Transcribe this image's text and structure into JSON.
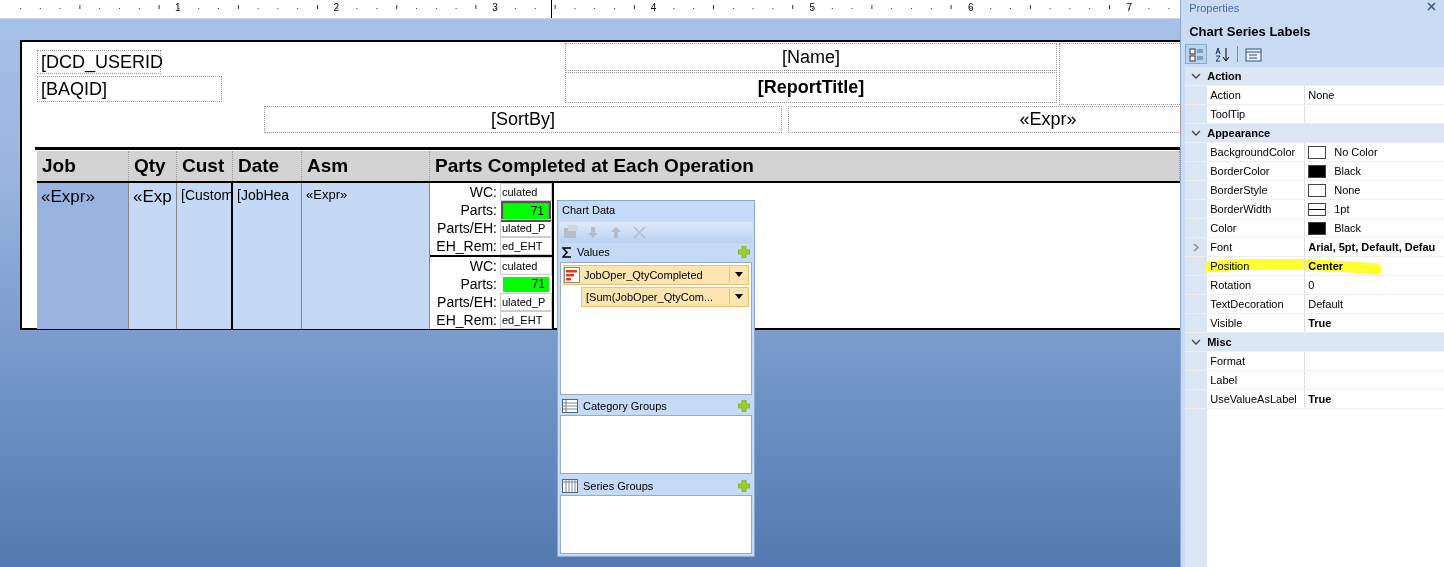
{
  "ruler": {
    "numbers": [
      "1",
      "2",
      "3",
      "4",
      "5",
      "6",
      "7"
    ]
  },
  "report": {
    "fields": [
      {
        "kind": "userid",
        "text": "[DCD_USERID"
      },
      {
        "kind": "baqid",
        "text": "[BAQID]"
      },
      {
        "kind": "name",
        "text": "[Name]"
      },
      {
        "kind": "title",
        "text": "[ReportTitle]"
      },
      {
        "kind": "sortby",
        "text": "[SortBy]"
      },
      {
        "kind": "expr",
        "text": "«Expr»"
      }
    ],
    "columns": [
      "Job",
      "Qty",
      "Cust",
      "Date",
      "Asm",
      "Parts Completed at Each Operation"
    ],
    "cells": [
      "«Expr»",
      "«Exp",
      "[Custom",
      "[JobHea",
      "«Expr»"
    ],
    "operations": [
      {
        "rows": [
          {
            "label": "WC:",
            "value": "culated",
            "kind": "text"
          },
          {
            "label": "Parts:",
            "value": "71",
            "kind": "bar",
            "selected": true
          },
          {
            "label": "Parts/EH:",
            "value": "ulated_P",
            "kind": "text"
          },
          {
            "label": "EH_Rem:",
            "value": "ed_EHT",
            "kind": "text"
          }
        ]
      },
      {
        "rows": [
          {
            "label": "WC:",
            "value": "culated",
            "kind": "text"
          },
          {
            "label": "Parts:",
            "value": "71",
            "kind": "bar",
            "selected": false
          },
          {
            "label": "Parts/EH:",
            "value": "ulated_P",
            "kind": "text"
          },
          {
            "label": "EH_Rem:",
            "value": "ed_EHT",
            "kind": "text"
          }
        ]
      }
    ]
  },
  "chart_data_panel": {
    "title": "Chart Data",
    "toolbar": [
      {
        "kind": "properties",
        "disabled": true
      },
      {
        "kind": "down",
        "disabled": true
      },
      {
        "kind": "up",
        "disabled": true
      },
      {
        "kind": "delete",
        "disabled": true
      }
    ],
    "sections": [
      {
        "kind": "values",
        "title": "Values",
        "items": [
          {
            "text": "JobOper_QtyCompleted",
            "kind": "series",
            "children": [
              {
                "text": "[Sum(JobOper_QtyCom...",
                "kind": "value"
              }
            ]
          }
        ]
      },
      {
        "kind": "category",
        "title": "Category Groups"
      },
      {
        "kind": "series",
        "title": "Series Groups"
      }
    ]
  },
  "properties": {
    "title": "Properties",
    "object": "Chart Series Labels",
    "toolbar": [
      {
        "kind": "categorized",
        "selected": true
      },
      {
        "kind": "alphabetical",
        "selected": false
      },
      {
        "kind": "pages",
        "selected": false
      }
    ],
    "groups": [
      {
        "title": "Action",
        "expanded": true,
        "rows": [
          {
            "name": "Action",
            "value": "None",
            "bold": false
          },
          {
            "name": "ToolTip",
            "value": "",
            "bold": false
          }
        ]
      },
      {
        "title": "Appearance",
        "expanded": true,
        "rows": [
          {
            "name": "BackgroundColor",
            "value": "No Color",
            "bold": false,
            "color": "#ffffff"
          },
          {
            "name": "BorderColor",
            "value": "Black",
            "bold": false,
            "color": "#000000"
          },
          {
            "name": "BorderStyle",
            "value": "None",
            "bold": false,
            "color": "#ffffff"
          },
          {
            "name": "BorderWidth",
            "value": "1pt",
            "bold": false,
            "kind": "line-width"
          },
          {
            "name": "Color",
            "value": "Black",
            "bold": false,
            "color": "#000000"
          },
          {
            "name": "Font",
            "value": "Arial, 5pt, Default, Defau",
            "bold": true,
            "expanded": false
          },
          {
            "name": "Position",
            "value": "Center",
            "bold": true,
            "highlighted": true
          },
          {
            "name": "Rotation",
            "value": "0",
            "bold": false
          },
          {
            "name": "TextDecoration",
            "value": "Default",
            "bold": false
          },
          {
            "name": "Visible",
            "value": "True",
            "bold": true
          }
        ]
      },
      {
        "title": "Misc",
        "expanded": true,
        "rows": [
          {
            "name": "Format",
            "value": "",
            "bold": false
          },
          {
            "name": "Label",
            "value": "",
            "bold": false
          },
          {
            "name": "UseValueAsLabel",
            "value": "True",
            "bold": true
          }
        ]
      }
    ]
  }
}
